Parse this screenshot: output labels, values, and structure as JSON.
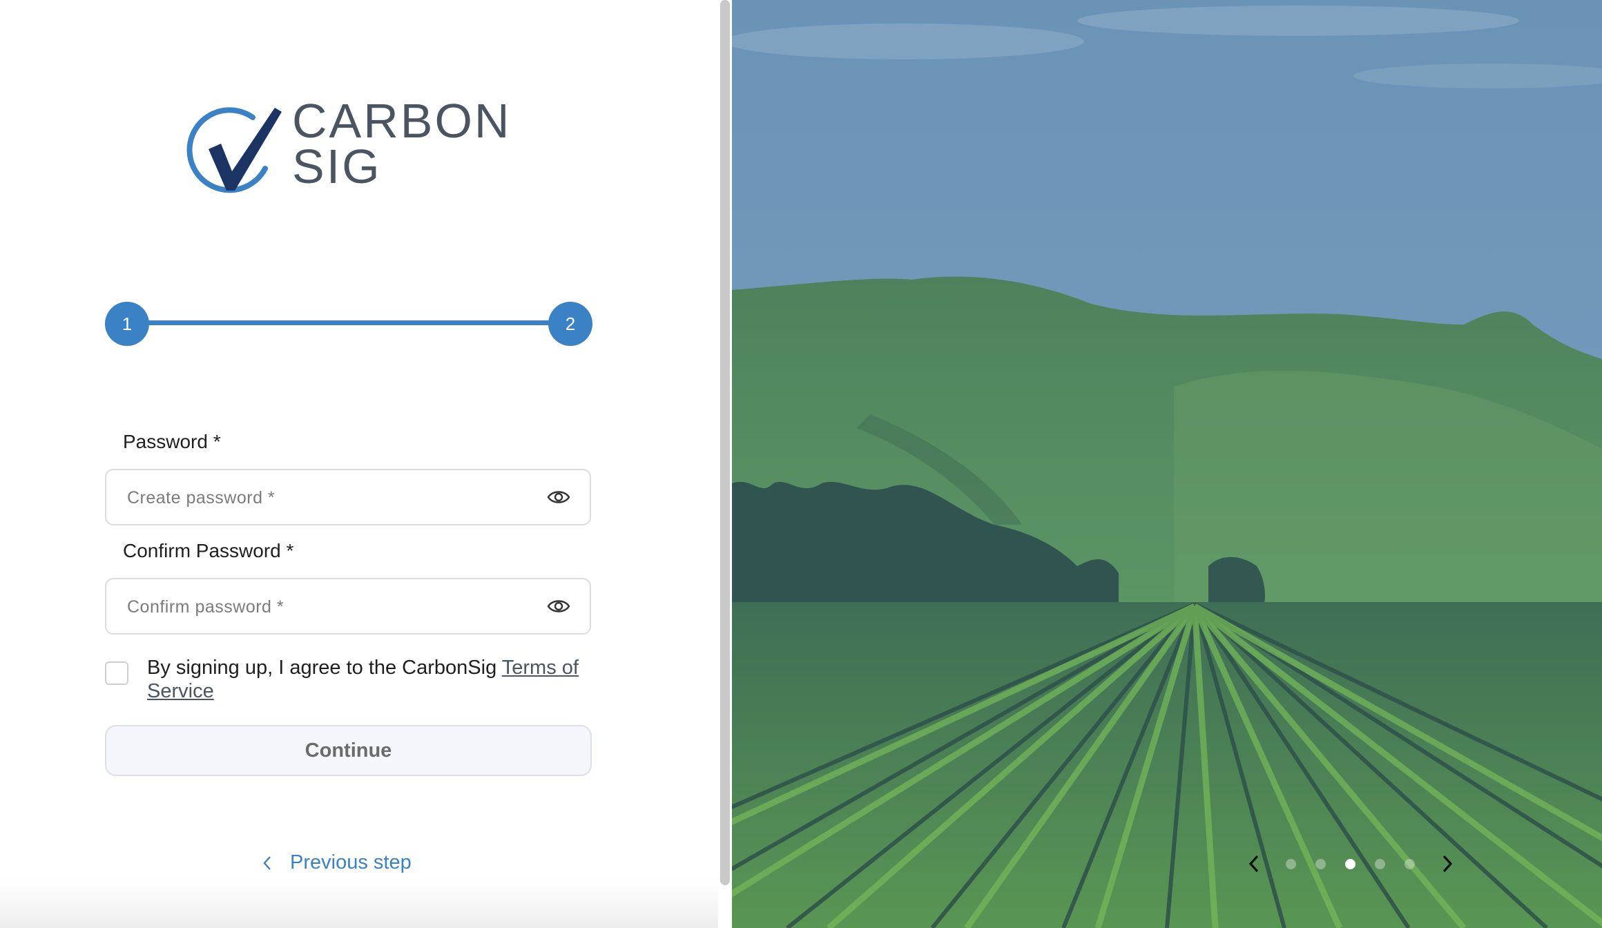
{
  "logo": {
    "line1": "CARBON",
    "line2": "SIG"
  },
  "stepper": {
    "steps": [
      "1",
      "2"
    ],
    "current": 2,
    "total": 2
  },
  "password": {
    "label": "Password *",
    "placeholder": "Create password *"
  },
  "confirm": {
    "label": "Confirm Password *",
    "placeholder": "Confirm password *"
  },
  "terms": {
    "prefix": "By signing up, I agree to the CarbonSig ",
    "link": "Terms of Service",
    "checked": false
  },
  "continue_label": "Continue",
  "previous_step": "Previous step",
  "carousel": {
    "slides": 5,
    "active_index": 3
  },
  "colors": {
    "accent": "#3a81c6",
    "brand_text": "#4a5561",
    "overlay": "#4b78a6"
  },
  "icons": {
    "eye": "eye-icon",
    "back": "chevron-left-icon",
    "carousel_prev": "chevron-left-icon",
    "carousel_next": "chevron-right-icon"
  }
}
